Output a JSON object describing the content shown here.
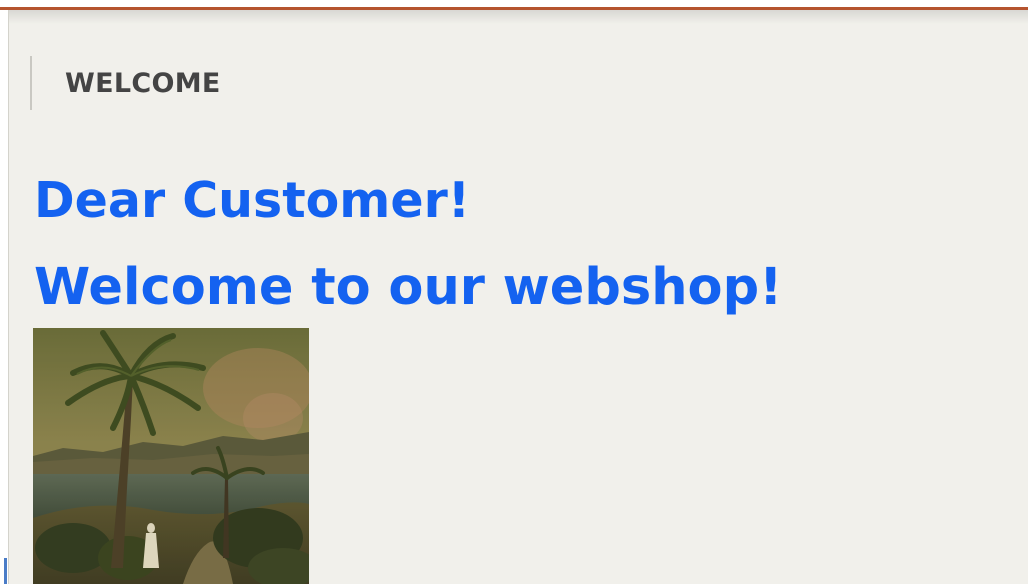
{
  "section": {
    "title": "WELCOME"
  },
  "greeting": {
    "line1": "Dear Customer!",
    "line2": "Welcome to our webshop!"
  },
  "colors": {
    "accent_rule": "#b5542f",
    "heading_blue": "#1462f0",
    "section_title": "#444444",
    "background": "#f1f0eb"
  },
  "image": {
    "subject": "palm-tree-painting"
  }
}
